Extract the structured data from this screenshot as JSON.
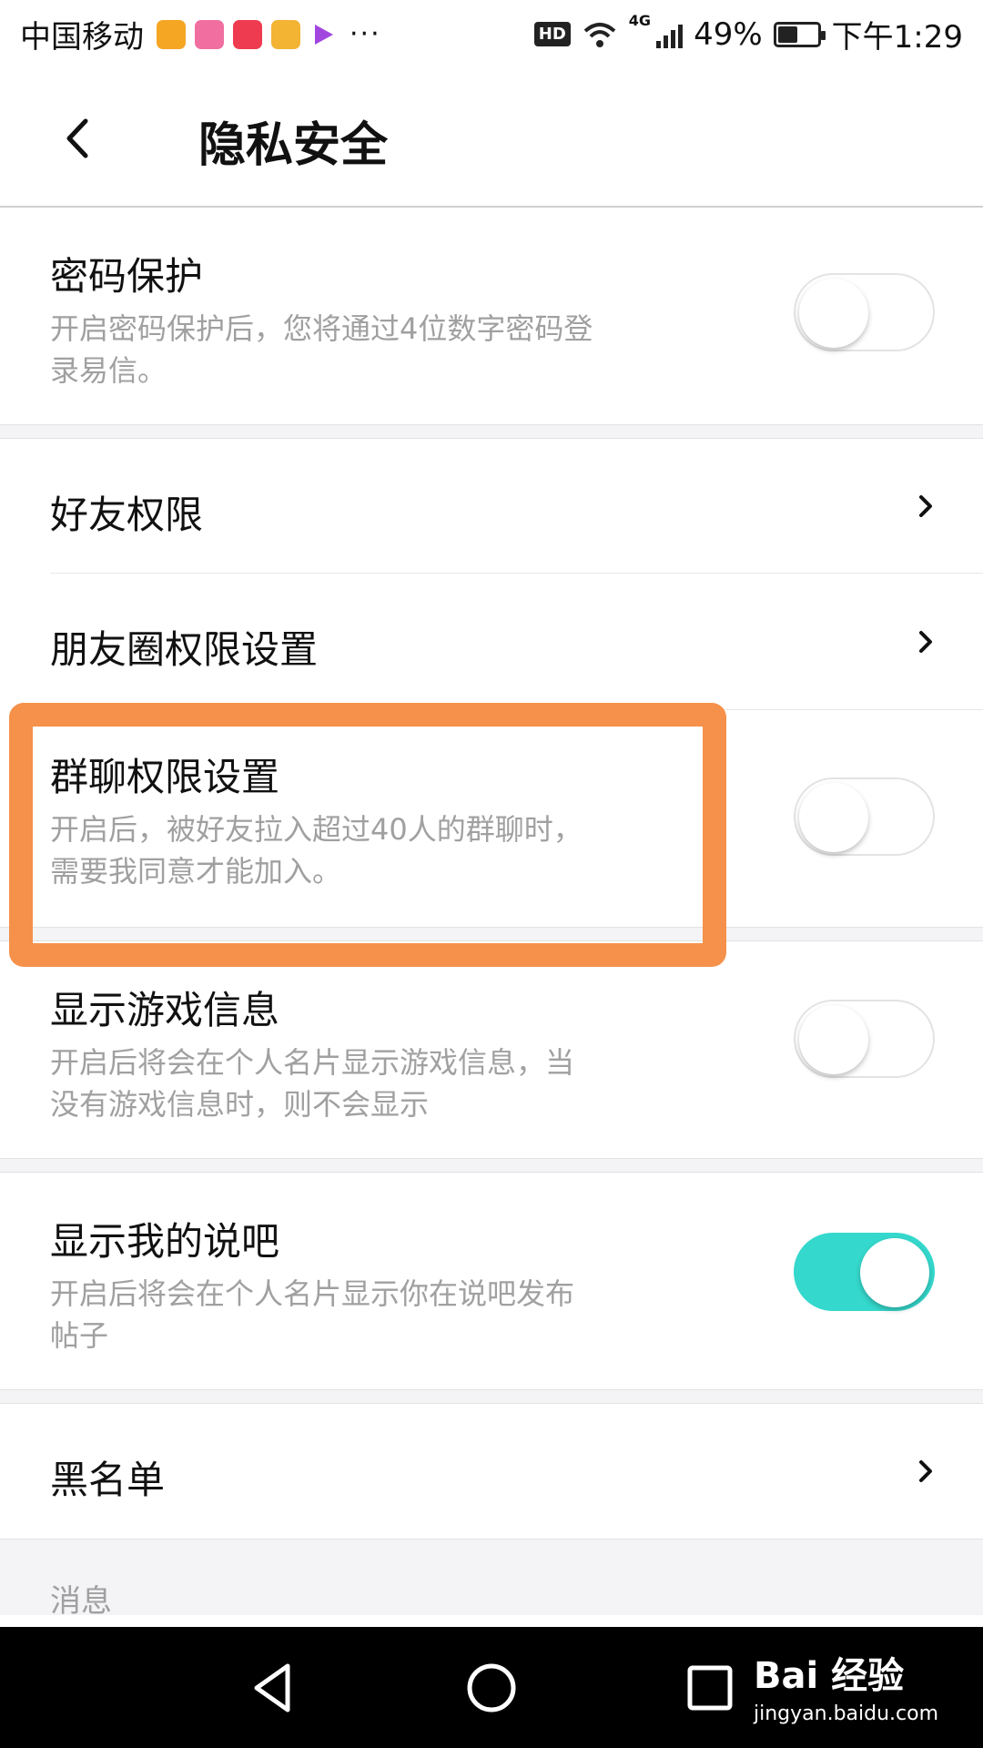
{
  "status_bar": {
    "carrier": "中国移动",
    "app_icons": [
      {
        "name": "weibo-icon",
        "color": "#f5a623"
      },
      {
        "name": "app-icon-pink",
        "color": "#f06fa0"
      },
      {
        "name": "app-icon-red",
        "color": "#ee3b4f"
      },
      {
        "name": "app-icon-yellow",
        "color": "#f3b333"
      },
      {
        "name": "video-play-icon",
        "color": "#a246e0"
      }
    ],
    "more_dots": "···",
    "hd_badge": "HD",
    "network": "4G",
    "battery_percent_label": "49%",
    "battery_level": 0.49,
    "time": "下午1:29"
  },
  "header": {
    "title": "隐私安全",
    "back_icon": "back-chevron-icon"
  },
  "settings": {
    "password_protect": {
      "title": "密码保护",
      "desc_line1": "开启密码保护后，您将通过4位数字密码登",
      "desc_line2": "录易信。",
      "enabled": false
    },
    "friend_permission": {
      "title": "好友权限"
    },
    "moments_permission": {
      "title": "朋友圈权限设置"
    },
    "group_chat_permission": {
      "title": "群聊权限设置",
      "desc_line1": "开启后，被好友拉入超过40人的群聊时，",
      "desc_line2": "需要我同意才能加入。",
      "enabled": false
    },
    "show_game_info": {
      "title": "显示游戏信息",
      "desc_line1": "开启后将会在个人名片显示游戏信息，当",
      "desc_line2": "没有游戏信息时，则不会显示",
      "enabled": false
    },
    "show_my_posts": {
      "title": "显示我的说吧",
      "desc_line1": "开启后将会在个人名片显示你在说吧发布",
      "desc_line2": "帖子",
      "enabled": true
    },
    "blacklist": {
      "title": "黑名单"
    },
    "messages_section_label": "消息"
  },
  "colors": {
    "toggle_on": "#35d8cc",
    "highlight": "#f5914a",
    "secondary_text": "#a0a0a0"
  },
  "watermark": {
    "main": "Bai  经验",
    "sub": "jingyan.baidu.com"
  }
}
